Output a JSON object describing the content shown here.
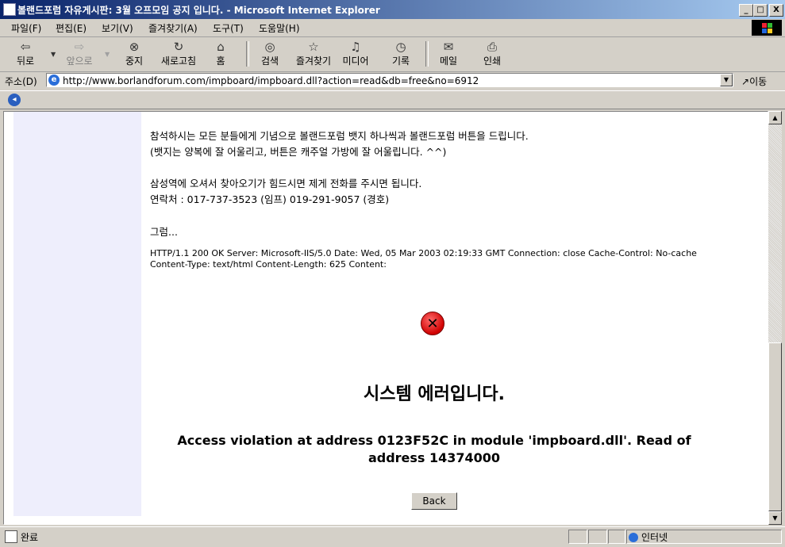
{
  "window": {
    "title": "볼랜드포럼 자유게시판: 3월 오프모임 공지 입니다. - Microsoft Internet Explorer",
    "minimize": "_",
    "maximize": "□",
    "close": "X"
  },
  "menu": [
    "파일(F)",
    "편집(E)",
    "보기(V)",
    "즐겨찾기(A)",
    "도구(T)",
    "도움말(H)"
  ],
  "toolbar": {
    "back": "뒤로",
    "forward": "앞으로",
    "stop": "중지",
    "refresh": "새로고침",
    "home": "홈",
    "search": "검색",
    "favorites": "즐겨찾기",
    "media": "미디어",
    "history": "기록",
    "mail": "메일",
    "print": "인쇄"
  },
  "address": {
    "label": "주소(D)",
    "url": "http://www.borlandforum.com/impboard/impboard.dll?action=read&db=free&no=6912",
    "go": "이동"
  },
  "page": {
    "line1": "참석하시는 모든 분들에게 기념으로 볼랜드포럼 뱃지 하나씩과 볼랜드포럼 버튼을 드립니다.",
    "line2": "(뱃지는 양복에 잘 어울리고, 버튼은 캐주얼 가방에 잘 어울립니다. ^^)",
    "line3": "삼성역에 오셔서 찾아오기가 힘드시면 제게 전화를 주시면 됩니다.",
    "line4": "연락처 : 017-737-3523 (임프) 019-291-9057 (경호)",
    "line5": "그럼...",
    "http_header": "HTTP/1.1 200 OK Server: Microsoft-IIS/5.0 Date: Wed, 05 Mar 2003 02:19:33 GMT Connection: close Cache-Control: No-cache Content-Type: text/html Content-Length: 625 Content:",
    "error_glyph": "✕",
    "system_error": "시스템 에러입니다.",
    "access_violation": "Access violation at address 0123F52C in module 'impboard.dll'. Read of address 14374000",
    "back_button": "Back"
  },
  "status": {
    "text": "완료",
    "zone": "인터넷"
  }
}
